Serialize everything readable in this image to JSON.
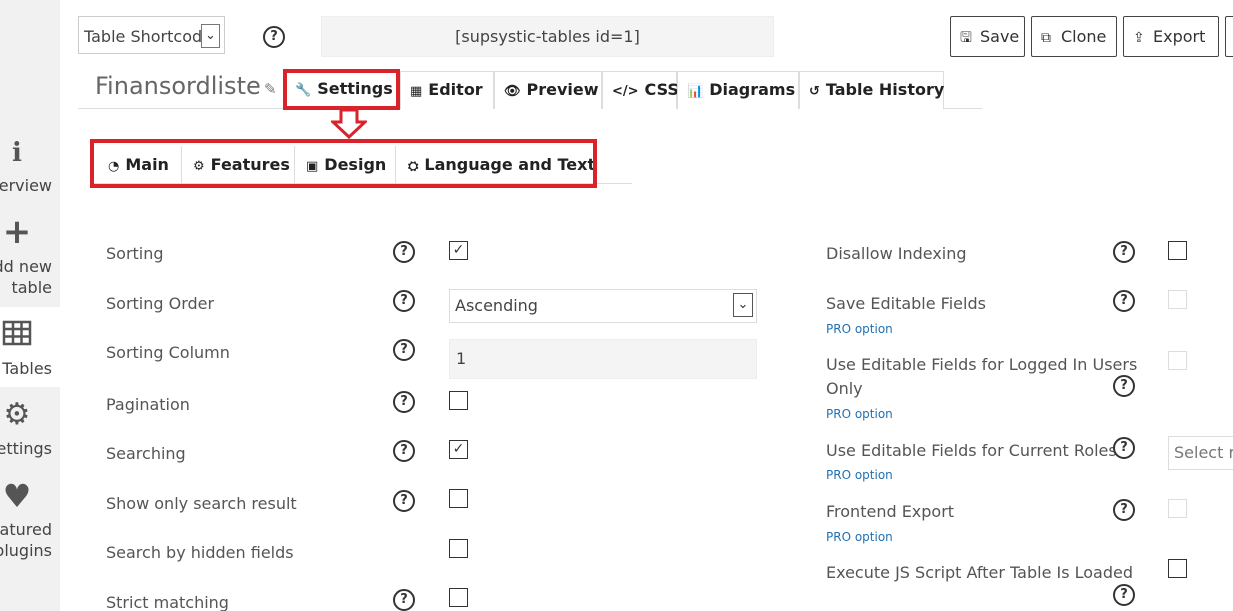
{
  "sidebar": {
    "items": [
      {
        "label_lines": [
          "Overview"
        ],
        "icon": "info-icon"
      },
      {
        "label_lines": [
          "Add new",
          "table"
        ],
        "icon": "plus-icon"
      },
      {
        "label_lines": [
          "Tables"
        ],
        "icon": "grid-icon",
        "active": true
      },
      {
        "label_lines": [
          "Settings"
        ],
        "icon": "gear-icon"
      },
      {
        "label_lines": [
          "Featured",
          "plugins"
        ],
        "icon": "heart-icon"
      }
    ]
  },
  "header": {
    "shortcode_select_value": "Table Shortcode",
    "shortcode_value": "[supsystic-tables id=1]",
    "buttons": {
      "save": "Save",
      "clone": "Clone",
      "export": "Export"
    }
  },
  "table": {
    "title": "Finansordliste"
  },
  "tabs": {
    "settings": "Settings",
    "editor": "Editor",
    "preview": "Preview",
    "css": "CSS",
    "diagrams": "Diagrams",
    "history": "Table History"
  },
  "subtabs": {
    "main": "Main",
    "features": "Features",
    "design": "Design",
    "language": "Language and Text"
  },
  "settings_left": {
    "sorting": {
      "label": "Sorting",
      "checked": true
    },
    "sorting_order": {
      "label": "Sorting Order",
      "value": "Ascending"
    },
    "sorting_column": {
      "label": "Sorting Column",
      "value": "1"
    },
    "pagination": {
      "label": "Pagination",
      "checked": false
    },
    "searching": {
      "label": "Searching",
      "checked": true
    },
    "show_only_search": {
      "label": "Show only search result",
      "checked": false
    },
    "search_hidden": {
      "label": "Search by hidden fields",
      "checked": false
    },
    "strict_matching": {
      "label": "Strict matching",
      "checked": false
    }
  },
  "settings_right": {
    "disallow_indexing": {
      "label": "Disallow Indexing"
    },
    "save_editable": {
      "label": "Save Editable Fields",
      "pro": "PRO option"
    },
    "editable_logged": {
      "label_lines": [
        "Use Editable Fields for Logged In Users",
        "Only"
      ],
      "pro": "PRO option"
    },
    "editable_roles": {
      "label": "Use Editable Fields for Current Roles",
      "pro": "PRO option",
      "placeholder": "Select ro"
    },
    "frontend_export": {
      "label": "Frontend Export",
      "pro": "PRO option"
    },
    "execute_js": {
      "label": "Execute JS Script After Table Is Loaded"
    }
  },
  "icons": {
    "help": "?",
    "check": "✓",
    "dropdown": "⌄"
  },
  "colors": {
    "highlight": "#d9222a",
    "pro_link": "#2271b1",
    "sidebar_bg": "#f1f1f1"
  }
}
